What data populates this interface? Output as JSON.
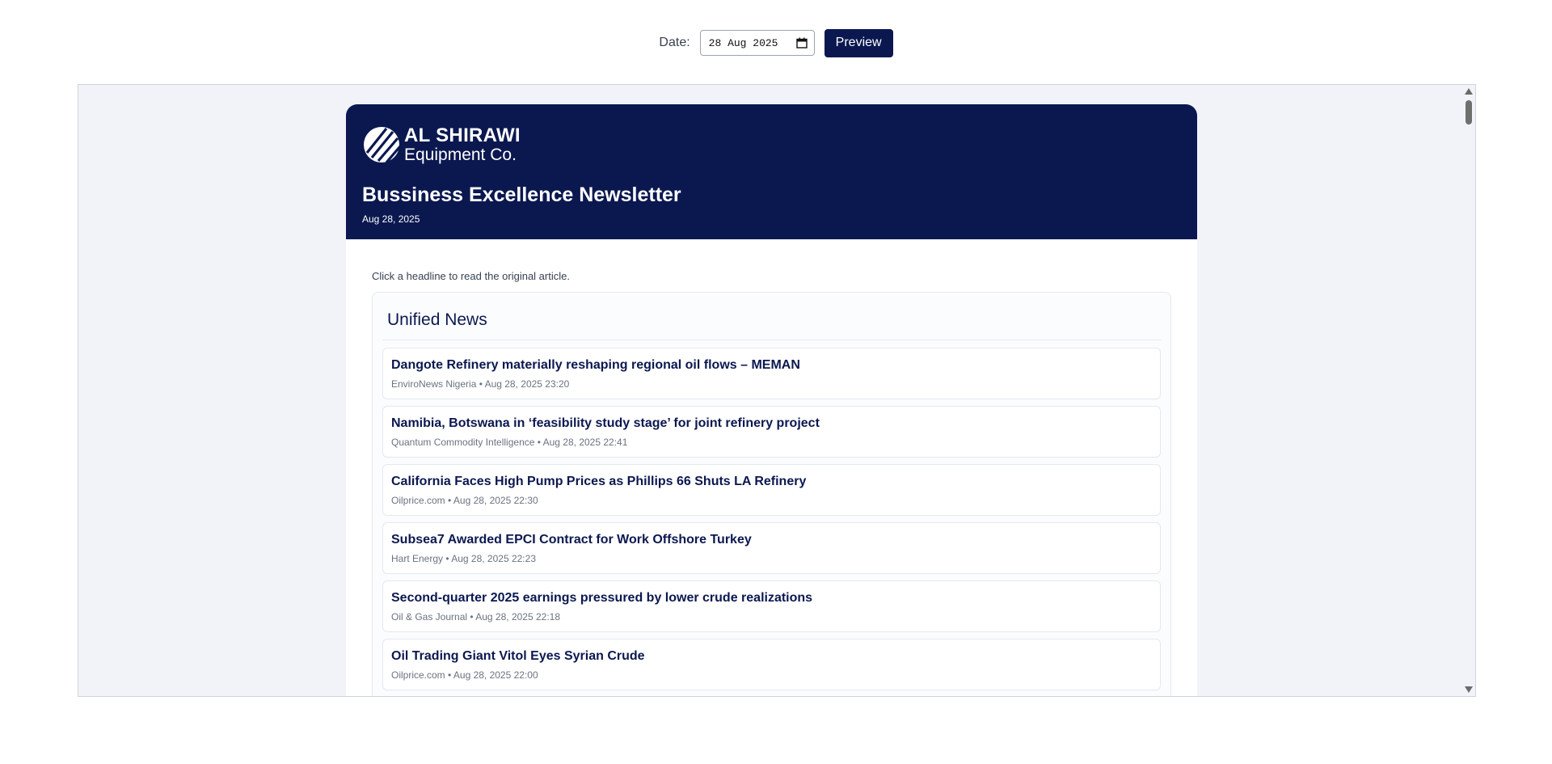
{
  "toolbar": {
    "date_label": "Date:",
    "date_value": "28 Aug 2025",
    "calendar_icon": "calendar-icon",
    "preview_label": "Preview"
  },
  "newsletter": {
    "logo": {
      "line1": "AL SHIRAWI",
      "line2": "Equipment Co."
    },
    "title": "Bussiness Excellence Newsletter",
    "date": "Aug 28, 2025",
    "intro": "Click a headline to read the original article.",
    "section_title": "Unified News",
    "articles": [
      {
        "title": "Dangote Refinery materially reshaping regional oil flows – MEMAN",
        "meta": "EnviroNews Nigeria • Aug 28, 2025 23:20"
      },
      {
        "title": "Namibia, Botswana in ‘feasibility study stage’ for joint refinery project",
        "meta": "Quantum Commodity Intelligence • Aug 28, 2025 22:41"
      },
      {
        "title": "California Faces High Pump Prices as Phillips 66 Shuts LA Refinery",
        "meta": "Oilprice.com • Aug 28, 2025 22:30"
      },
      {
        "title": "Subsea7 Awarded EPCI Contract for Work Offshore Turkey",
        "meta": "Hart Energy • Aug 28, 2025 22:23"
      },
      {
        "title": "Second-quarter 2025 earnings pressured by lower crude realizations",
        "meta": "Oil & Gas Journal • Aug 28, 2025 22:18"
      },
      {
        "title": "Oil Trading Giant Vitol Eyes Syrian Crude",
        "meta": "Oilprice.com • Aug 28, 2025 22:00"
      }
    ]
  },
  "colors": {
    "brand_navy": "#0b1850",
    "frame_bg": "#f1f3f8"
  }
}
